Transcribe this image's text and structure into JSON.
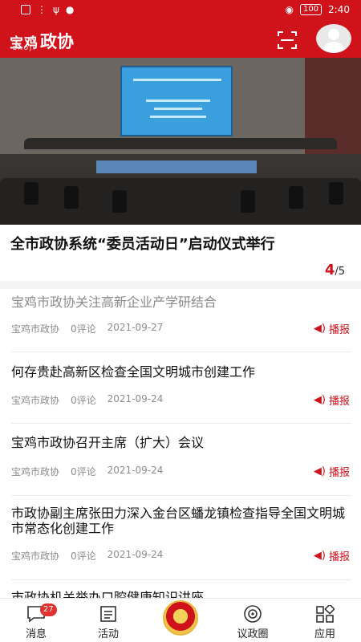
{
  "status_bar": {
    "battery": "100",
    "time": "2:40"
  },
  "header": {
    "brand_cn": "宝鸡",
    "brand_title": "政协",
    "brand_sub": "BAOJI"
  },
  "banner": {
    "headline": "全市政协系统“委员活动日”启动仪式举行",
    "page_current": "4",
    "page_total": "/5"
  },
  "news": [
    {
      "title": "宝鸡市政协关注高新企业产学研结合",
      "source": "宝鸡市政协",
      "comments": "0评论",
      "date": "2021-09-27",
      "play": "播报",
      "read": true
    },
    {
      "title": "何存贵赴高新区检查全国文明城市创建工作",
      "source": "宝鸡市政协",
      "comments": "0评论",
      "date": "2021-09-24",
      "play": "播报",
      "read": false
    },
    {
      "title": "宝鸡市政协召开主席（扩大）会议",
      "source": "宝鸡市政协",
      "comments": "0评论",
      "date": "2021-09-24",
      "play": "播报",
      "read": false
    },
    {
      "title": "市政协副主席张田力深入金台区蟠龙镇检查指导全国文明城市常态化创建工作",
      "source": "宝鸡市政协",
      "comments": "0评论",
      "date": "2021-09-24",
      "play": "播报",
      "read": false
    },
    {
      "title": "市政协机关举办口腔健康知识讲座"
    }
  ],
  "tabs": [
    {
      "label": "消息",
      "icon": "message-icon",
      "badge": "27"
    },
    {
      "label": "活动",
      "icon": "list-icon"
    },
    {
      "label": "",
      "icon": "cppcc-emblem-icon"
    },
    {
      "label": "议政圈",
      "icon": "circle-icon"
    },
    {
      "label": "应用",
      "icon": "apps-icon"
    }
  ],
  "colors": {
    "brand_red": "#d0121b",
    "read_gray": "#8a8a8a",
    "meta_gray": "#8c8c8c"
  }
}
